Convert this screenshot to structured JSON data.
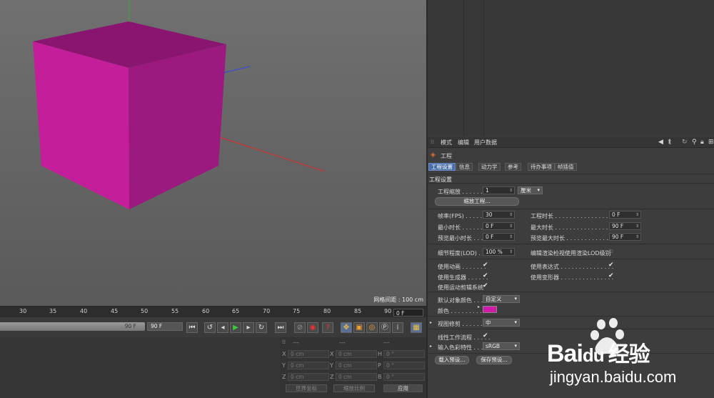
{
  "viewport": {
    "grid_spacing": "网格间距 : 100 cm",
    "object_color": "#c41e9a"
  },
  "timeline": {
    "ticks": [
      "30",
      "35",
      "40",
      "45",
      "50",
      "55",
      "60",
      "65",
      "70",
      "75",
      "80",
      "85",
      "90"
    ],
    "current_frame": "0 F",
    "scrub_end": "90 F",
    "end_frame": "90 F"
  },
  "coordinates": {
    "header_dashes": [
      "---",
      "---",
      "---"
    ],
    "rows": [
      {
        "a": "X",
        "av": "0 cm",
        "b": "X",
        "bv": "0 cm",
        "c": "H",
        "cv": "0 °"
      },
      {
        "a": "Y",
        "av": "0 cm",
        "b": "Y",
        "bv": "0 cm",
        "c": "P",
        "cv": "0 °"
      },
      {
        "a": "Z",
        "av": "0 cm",
        "b": "Z",
        "bv": "0 cm",
        "c": "B",
        "cv": "0 °"
      }
    ],
    "world_dropdown": "世界坐标",
    "scale_dropdown": "缩放比例",
    "apply_button": "应用"
  },
  "attributes": {
    "menu": [
      "模式",
      "编辑",
      "用户数据"
    ],
    "object_title": "工程",
    "tabs": [
      "工程设置",
      "信息",
      "动力学",
      "参考",
      "待办事项",
      "帧插值"
    ],
    "section_title": "工程设置",
    "project_scale_label": "工程缩放 . . . . . . . .",
    "project_scale_value": "1",
    "project_scale_unit": "厘米",
    "scale_project_button": "缩放工程...",
    "fps_label": "帧率(FPS) . . . . . . . .",
    "fps_value": "30",
    "project_length_label": "工程时长 . . . . . . . . . . . . . . . . .",
    "project_length_value": "0 F",
    "min_time_label": "最小时长 . . . . . . . .",
    "min_time_value": "0 F",
    "max_time_label": "最大时长 . . . . . . . . . . . . . . . . .",
    "max_time_value": "90 F",
    "preview_min_label": "预览最小时长 . . . .",
    "preview_min_value": "0 F",
    "preview_max_label": "预览最大时长 . . . . . . . . . . . . . .",
    "preview_max_value": "90 F",
    "lod_label": "细节程度(LOD) . .",
    "lod_value": "100 %",
    "lod_editor_label": "编辑渲染检视使用渲染LOD级别",
    "use_animation_label": "使用动画 . . . . . . .",
    "use_expression_label": "使用表达式 . . . . . . . . . . . . . . .",
    "use_generators_label": "使用生成器 . . . . . .",
    "use_deformers_label": "使用变形器 . . . . . . . . . . . . . . .",
    "use_motion_label": "使用运动剪辑系统",
    "default_color_label": "默认对象颜色 . . .",
    "default_color_value": "自定义",
    "color_label": "颜色 . . . . . . . . .",
    "color_swatch": "#d21aa8",
    "view_clipping_label": "视图修剪 . . . . . . . . .",
    "view_clipping_value": "中",
    "linear_workflow_label": "线性工作流程 . . . . .",
    "input_color_label": "输入色彩特性 . . . . . .",
    "input_color_value": "sRGB",
    "load_preset_button": "载入预设...",
    "save_preset_button": "保存预设..."
  },
  "watermark": {
    "brand_left": "Bai",
    "brand_mid": "du",
    "brand_cn": "经验",
    "url": "jingyan.baidu.com"
  }
}
